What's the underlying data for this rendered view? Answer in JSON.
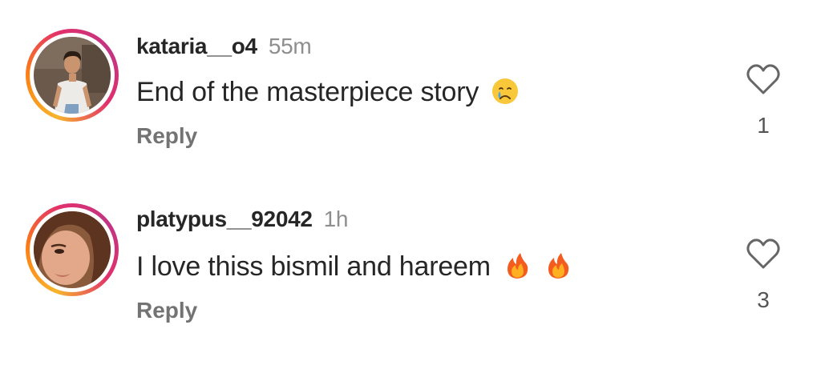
{
  "comments": [
    {
      "username": "kataria__o4",
      "time": "55m",
      "text": "End of the masterpiece story",
      "emojis": [
        "crying-face"
      ],
      "reply_label": "Reply",
      "likes": "1"
    },
    {
      "username": "platypus__92042",
      "time": "1h",
      "text": "I love thiss bismil and hareem",
      "emojis": [
        "fire",
        "fire"
      ],
      "reply_label": "Reply",
      "likes": "3"
    }
  ],
  "colors": {
    "text": "#262626",
    "muted": "#8e8e8e",
    "reply": "#737373",
    "ring_gradient": [
      "#f7b42c",
      "#e1306c",
      "#c13584"
    ]
  }
}
